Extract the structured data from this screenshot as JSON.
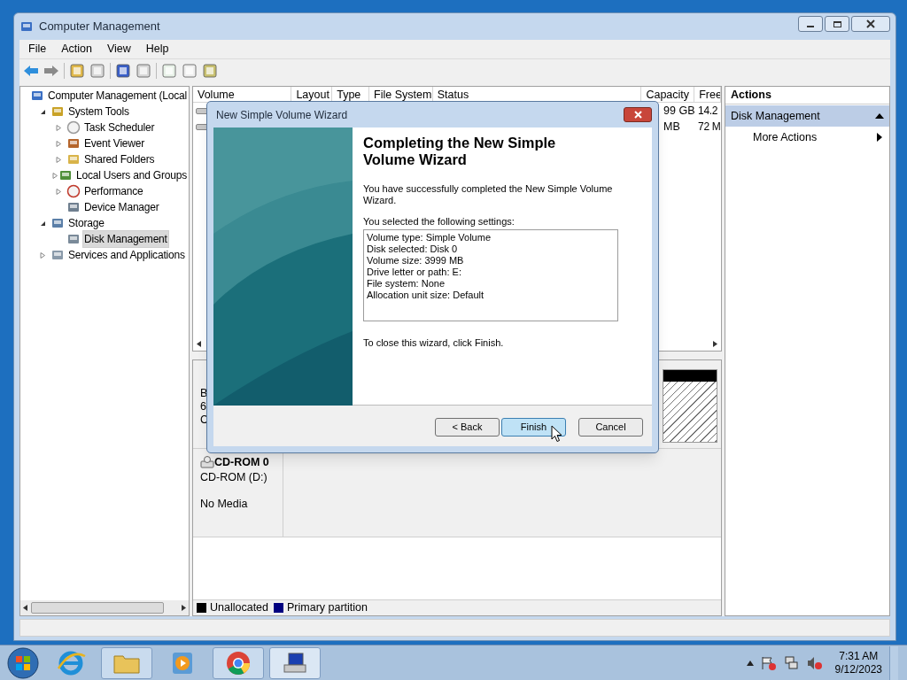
{
  "window": {
    "title": "Computer Management"
  },
  "menu": [
    "File",
    "Action",
    "View",
    "Help"
  ],
  "tree": [
    {
      "label": "Computer Management (Local",
      "children": [
        {
          "label": "System Tools",
          "expanded": true,
          "selected": false,
          "children": [
            {
              "label": "Task Scheduler",
              "expanded": false,
              "selected": false
            },
            {
              "label": "Event Viewer",
              "expanded": false,
              "selected": false
            },
            {
              "label": "Shared Folders",
              "expanded": false,
              "selected": false
            },
            {
              "label": "Local Users and Groups",
              "expanded": false,
              "selected": false
            },
            {
              "label": "Performance",
              "expanded": false,
              "selected": false
            },
            {
              "label": "Device Manager",
              "selected": false
            }
          ]
        },
        {
          "label": "Storage",
          "expanded": true,
          "selected": false,
          "children": [
            {
              "label": "Disk Management",
              "selected": true
            }
          ]
        },
        {
          "label": "Services and Applications",
          "expanded": false,
          "selected": false
        }
      ]
    }
  ],
  "table": {
    "columns": [
      "Volume",
      "Layout",
      "Type",
      "File System",
      "Status",
      "Capacity",
      "Free"
    ],
    "rows": [
      {
        "capacity": "99 GB",
        "free": "14.2"
      },
      {
        "capacity": "MB",
        "free": "72 M"
      }
    ]
  },
  "disks": [
    {
      "kind": "disk",
      "label_lines": [
        "B",
        "6",
        "C"
      ]
    },
    {
      "kind": "cdrom",
      "name": "CD-ROM 0",
      "drive": "CD-ROM (D:)",
      "media": "No Media"
    }
  ],
  "legend": [
    {
      "label": "Unallocated",
      "color": "#000000"
    },
    {
      "label": "Primary partition",
      "color": "#00007f"
    }
  ],
  "actions": {
    "header": "Actions",
    "section": "Disk Management",
    "expanded": true,
    "items": [
      "More Actions"
    ]
  },
  "dialog": {
    "title": "New Simple Volume Wizard",
    "heading": "Completing the New Simple Volume Wizard",
    "intro": "You have successfully completed the New Simple Volume Wizard.",
    "settings_label": "You selected the following settings:",
    "settings": [
      "Volume type: Simple Volume",
      "Disk selected: Disk 0",
      "Volume size: 3999 MB",
      "Drive letter or path: E:",
      "File system: None",
      "Allocation unit size: Default"
    ],
    "closing": "To close this wizard, click Finish.",
    "buttons": [
      {
        "label": "< Back",
        "default": false
      },
      {
        "label": "Finish",
        "default": true
      },
      {
        "label": "Cancel",
        "default": false
      }
    ]
  },
  "clock": {
    "time": "7:31 AM",
    "date": "9/12/2023"
  }
}
